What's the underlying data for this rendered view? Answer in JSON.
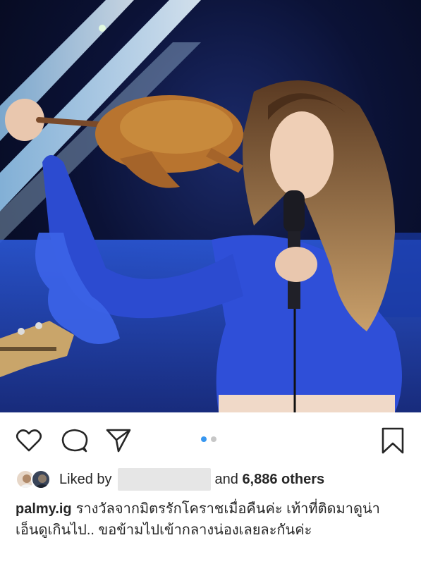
{
  "photo": {
    "description_icon": "concert-photo"
  },
  "actions": {
    "like_icon": "heart-icon",
    "comment_icon": "comment-icon",
    "share_icon": "send-icon",
    "save_icon": "bookmark-icon",
    "carousel": {
      "total": 2,
      "current": 1
    }
  },
  "likes": {
    "prefix": "Liked by",
    "joiner": "and",
    "count_text": "6,886 others"
  },
  "caption": {
    "username": "palmy.ig",
    "text": "รางวัลจากมิตรรักโคราชเมื่อคืนค่ะ เท้าที่ติดมาดูน่าเอ็นดูเกินไป.. ขอข้ามไปเข้ากลางน่องเลยละกันค่ะ"
  },
  "colors": {
    "accent_dot": "#3897f0",
    "text": "#262626",
    "stage_blue": "#2448c8"
  }
}
